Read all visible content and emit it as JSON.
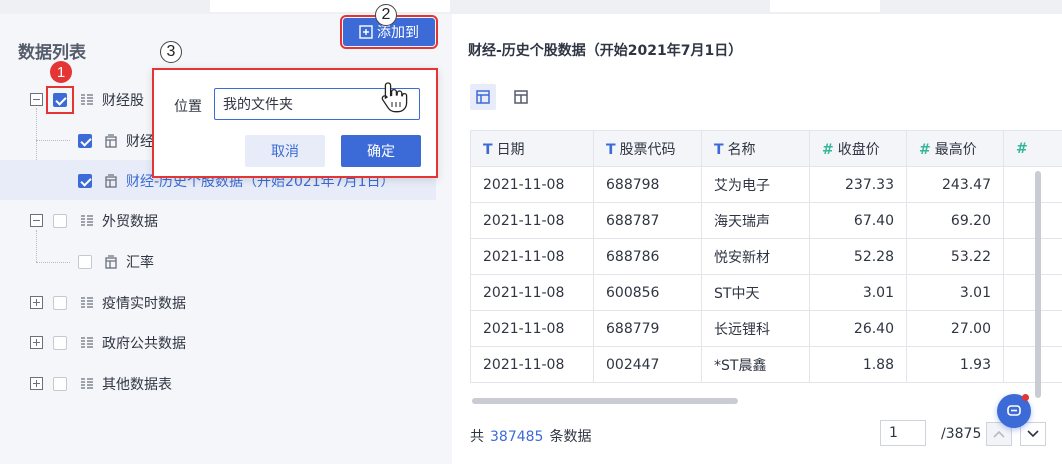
{
  "left_panel": {
    "title": "数据列表",
    "add_button_label": "添加到",
    "tree": [
      {
        "label": "财经股",
        "kind": "folder",
        "checked": true
      },
      {
        "label": "财经",
        "kind": "table",
        "checked": true
      },
      {
        "label": "财经-历史个股数据（开始2021年7月1日）",
        "kind": "table",
        "checked": true
      },
      {
        "label": "外贸数据",
        "kind": "folder",
        "checked": false
      },
      {
        "label": "汇率",
        "kind": "table",
        "checked": false
      },
      {
        "label": "疫情实时数据",
        "kind": "folder",
        "checked": false
      },
      {
        "label": "政府公共数据",
        "kind": "folder",
        "checked": false
      },
      {
        "label": "其他数据表",
        "kind": "folder",
        "checked": false
      }
    ]
  },
  "popup": {
    "position_label": "位置",
    "position_value": "我的文件夹",
    "cancel_label": "取消",
    "ok_label": "确定"
  },
  "annotations": {
    "badge1": "1",
    "badge2": "2",
    "badge3": "3"
  },
  "right_panel": {
    "title": "财经-历史个股数据（开始2021年7月1日）",
    "columns": [
      {
        "type": "T",
        "label": "日期"
      },
      {
        "type": "T",
        "label": "股票代码"
      },
      {
        "type": "T",
        "label": "名称"
      },
      {
        "type": "#",
        "label": "收盘价"
      },
      {
        "type": "#",
        "label": "最高价"
      },
      {
        "type": "#",
        "label": ""
      }
    ],
    "rows": [
      [
        "2021-11-08",
        "688798",
        "艾为电子",
        "237.33",
        "243.47"
      ],
      [
        "2021-11-08",
        "688787",
        "海天瑞声",
        "67.40",
        "69.20"
      ],
      [
        "2021-11-08",
        "688786",
        "悦安新材",
        "52.28",
        "53.22"
      ],
      [
        "2021-11-08",
        "600856",
        "ST中天",
        "3.01",
        "3.01"
      ],
      [
        "2021-11-08",
        "688779",
        "长远锂科",
        "26.40",
        "27.00"
      ],
      [
        "2021-11-08",
        "002447",
        "*ST晨鑫",
        "1.88",
        "1.93"
      ]
    ],
    "footer_prefix": "共",
    "record_count": "387485",
    "footer_suffix": "条数据",
    "current_page": "1",
    "total_pages": "/3875"
  },
  "colors": {
    "accent": "#3c6bd7",
    "highlight": "#e53434",
    "number_type": "#37b79a"
  }
}
